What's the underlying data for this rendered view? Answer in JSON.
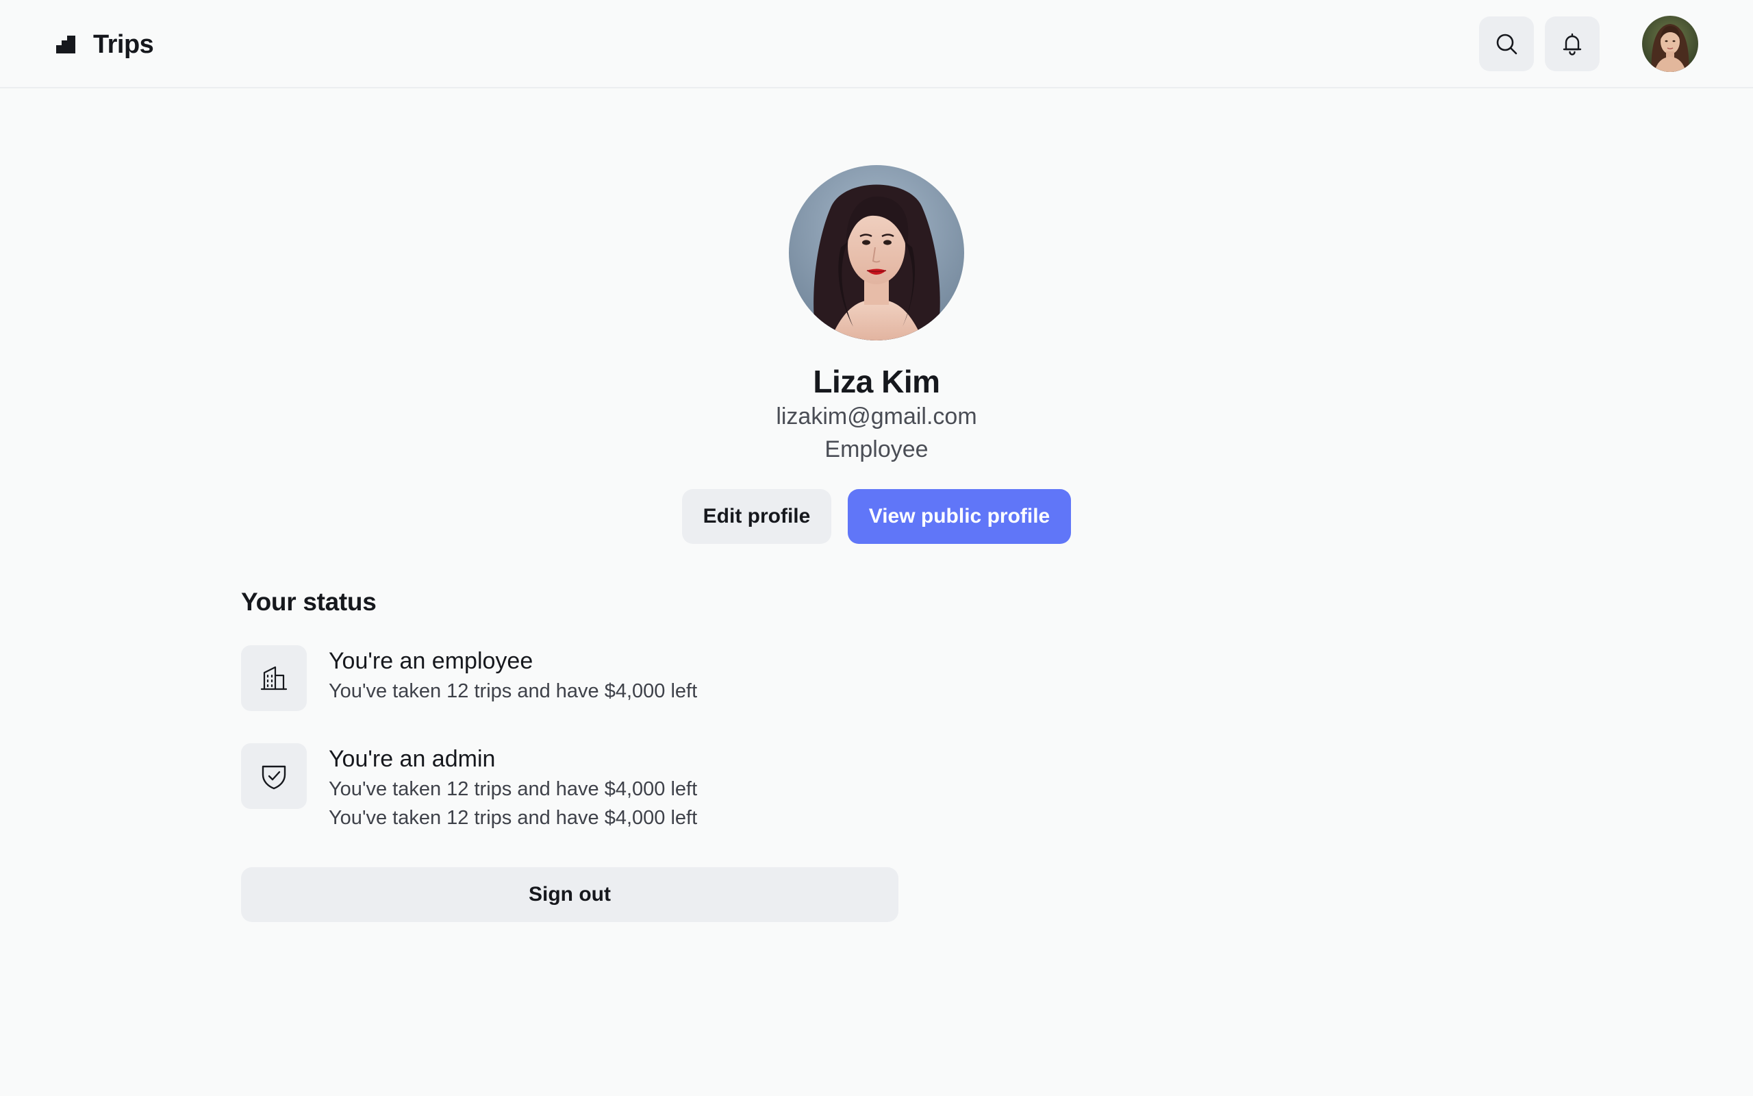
{
  "header": {
    "app_title": "Trips",
    "logo_icon": "stairs-logo-icon",
    "search_icon": "search-icon",
    "notifications_icon": "bell-icon",
    "avatar_icon": "user-avatar"
  },
  "profile": {
    "name": "Liza Kim",
    "email": "lizakim@gmail.com",
    "role": "Employee",
    "edit_label": "Edit profile",
    "public_label": "View public profile"
  },
  "status": {
    "heading": "Your status",
    "items": [
      {
        "icon": "building-icon",
        "title": "You're an employee",
        "lines": [
          "You've taken 12 trips and have $4,000 left"
        ]
      },
      {
        "icon": "shield-check-icon",
        "title": "You're an admin",
        "lines": [
          "You've taken 12 trips and have $4,000 left",
          "You've taken 12 trips and have $4,000 left"
        ]
      }
    ]
  },
  "signout_label": "Sign out",
  "colors": {
    "background": "#f9fafa",
    "accent": "#6076f8",
    "button_gray": "#eceef1",
    "text_primary": "#16181d",
    "text_secondary": "#4a4d55"
  }
}
